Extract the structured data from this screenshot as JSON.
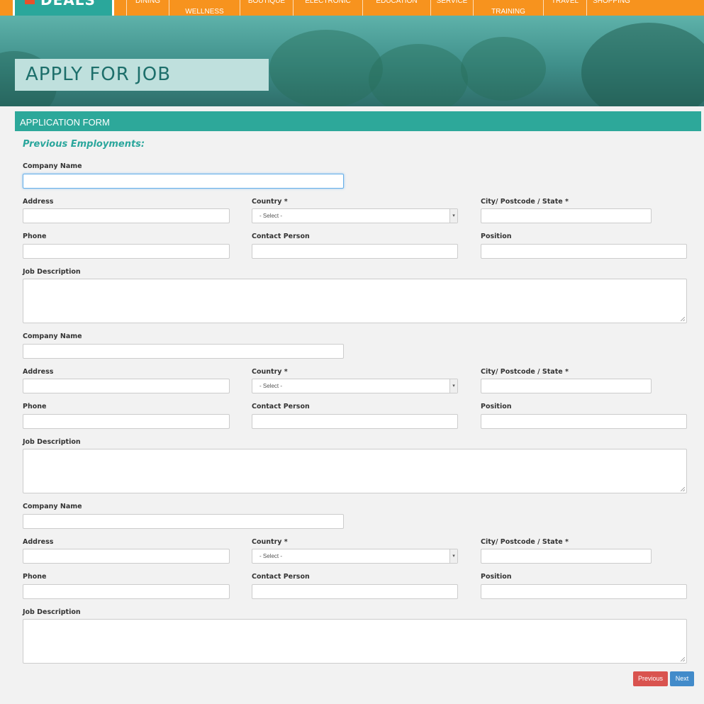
{
  "nav": {
    "logo_text": "DEALS",
    "items": [
      {
        "label": "DINING",
        "w": 60
      },
      {
        "label": "WELLNESS",
        "w": 100
      },
      {
        "label": "BOUTIQUE",
        "w": 75
      },
      {
        "label": "ELECTRONIC",
        "w": 98
      },
      {
        "label": "EDUCATION",
        "w": 96
      },
      {
        "label": "SERVICE",
        "w": 60
      },
      {
        "label": "TRAINING",
        "w": 99
      },
      {
        "label": "TRAVEL",
        "w": 61
      },
      {
        "label": "SHOPPING",
        "w": 70
      }
    ]
  },
  "banner": {
    "title": "APPLY FOR JOB"
  },
  "form": {
    "header": "APPLICATION FORM",
    "section_title": "Previous Employments:",
    "labels": {
      "company_name": "Company Name",
      "address": "Address",
      "country": "Country *",
      "city": "City/ Postcode / State *",
      "phone": "Phone",
      "contact_person": "Contact Person",
      "position": "Position",
      "job_description": "Job Description"
    },
    "select_placeholder": "- Select -",
    "entries": 3
  },
  "buttons": {
    "previous": "Previous",
    "next": "Next"
  },
  "colors": {
    "nav": "#f7931e",
    "teal": "#2da89a",
    "previous": "#d9534f",
    "next": "#428bca"
  }
}
